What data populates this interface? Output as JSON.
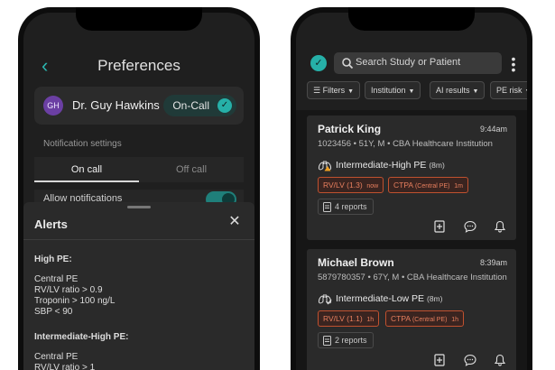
{
  "preferences": {
    "title": "Preferences",
    "user": {
      "initials": "GH",
      "name": "Dr. Guy Hawkins",
      "status": "On-Call"
    },
    "notification_settings_label": "Notification settings",
    "tabs": [
      "On call",
      "Off call"
    ],
    "allow_notifications_label": "Allow notifications",
    "allow_notifications_on": true
  },
  "alerts_sheet": {
    "title": "Alerts",
    "sections": [
      {
        "title": "High PE:",
        "lines": [
          "Central PE",
          "RV/LV ratio > 0.9",
          "Troponin > 100 ng/L",
          "SBP < 90"
        ]
      },
      {
        "title": "Intermediate-High PE:",
        "lines": [
          "Central PE",
          "RV/LV ratio > 1"
        ]
      }
    ]
  },
  "worklist": {
    "search_placeholder": "Search Study or Patient",
    "filters": [
      "Filters",
      "Institution",
      "AI results",
      "PE risk"
    ],
    "cards": [
      {
        "name": "Patrick King",
        "time": "9:44am",
        "meta": "1023456 • 51Y, M • CBA Healthcare Institution",
        "risk": "Intermediate-High PE",
        "risk_duration": "(8m)",
        "tag1": {
          "label": "RV/LV",
          "value": "(1.3)",
          "time": "now"
        },
        "tag2": {
          "label": "CTPA",
          "detail": "(Central PE)",
          "time": "1m"
        },
        "reports": "4 reports"
      },
      {
        "name": "Michael Brown",
        "time": "8:39am",
        "meta": "5879780357 • 67Y, M • CBA Healthcare Institution",
        "risk": "Intermediate-Low PE",
        "risk_duration": "(8m)",
        "tag1": {
          "label": "RV/LV",
          "value": "(1.1)",
          "time": "1h"
        },
        "tag2": {
          "label": "CTPA",
          "detail": "(Central PE)",
          "time": "1h"
        },
        "reports": "2 reports"
      }
    ]
  },
  "colors": {
    "accent": "#26b0a8",
    "alert": "#e87f5e",
    "background": "#1f1f1f"
  }
}
